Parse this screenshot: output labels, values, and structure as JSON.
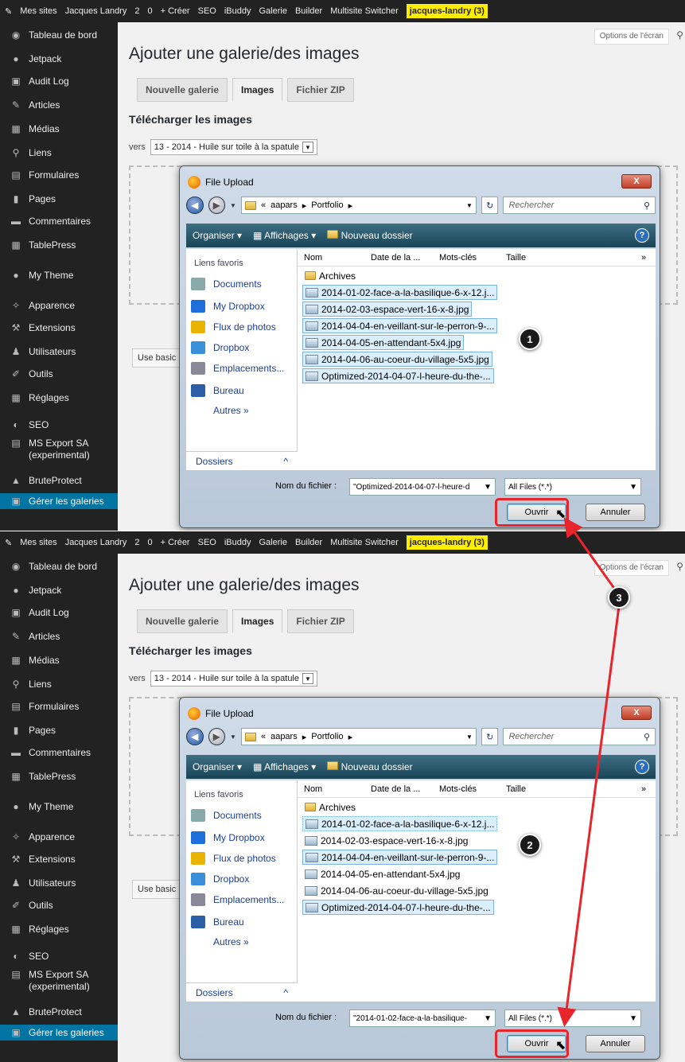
{
  "admin_bar": {
    "items": [
      "Mes sites",
      "Jacques Landry",
      "2",
      "0",
      "+ Créer",
      "SEO",
      "iBuddy",
      "Galerie",
      "Builder",
      "Multisite Switcher"
    ],
    "user": "jacques-landry (3)"
  },
  "sidebar": {
    "items": [
      {
        "label": "Tableau de bord",
        "icon": "dashboard-icon"
      },
      {
        "label": "Jetpack",
        "icon": "jetpack-icon"
      },
      {
        "label": "Audit Log",
        "icon": "audit-icon"
      },
      {
        "label": "Articles",
        "icon": "pin-icon"
      },
      {
        "label": "Médias",
        "icon": "media-icon"
      },
      {
        "label": "Liens",
        "icon": "link-icon"
      },
      {
        "label": "Formulaires",
        "icon": "form-icon"
      },
      {
        "label": "Pages",
        "icon": "page-icon"
      },
      {
        "label": "Commentaires",
        "icon": "comment-icon"
      },
      {
        "label": "TablePress",
        "icon": "table-icon"
      },
      {
        "label": "My Theme",
        "icon": "theme-icon"
      },
      {
        "label": "Apparence",
        "icon": "brush-icon"
      },
      {
        "label": "Extensions",
        "icon": "plugin-icon"
      },
      {
        "label": "Utilisateurs",
        "icon": "users-icon"
      },
      {
        "label": "Outils",
        "icon": "wrench-icon"
      },
      {
        "label": "Réglages",
        "icon": "settings-icon"
      },
      {
        "label": "SEO",
        "icon": "seo-icon"
      },
      {
        "label": "MS Export SA (experimental)",
        "icon": "export-icon"
      },
      {
        "label": "BruteProtect",
        "icon": "lock-icon"
      },
      {
        "label": "Gérer les galeries",
        "icon": "gallery-icon"
      }
    ]
  },
  "page": {
    "screen_options": "Options de l'écran",
    "title": "Ajouter une galerie/des images",
    "tabs": [
      "Nouvelle galerie",
      "Images",
      "Fichier ZIP"
    ],
    "active_tab": "Images",
    "section_title": "Télécharger les images",
    "vers_label": "vers",
    "gallery_select": "13 - 2014 - Huile sur toile à la spatule",
    "basic_button": "Use basic"
  },
  "dialog": {
    "title": "File Upload",
    "close": "X",
    "path_prefix": "«",
    "path": [
      "aapars",
      "Portfolio"
    ],
    "search_placeholder": "Rechercher",
    "toolbar": {
      "organize": "Organiser",
      "views": "Affichages",
      "new_folder": "Nouveau dossier"
    },
    "favorites_label": "Liens favoris",
    "favorites": [
      "Documents",
      "My Dropbox",
      "Flux de photos",
      "Dropbox",
      "Emplacements...",
      "Bureau",
      "Autres »"
    ],
    "folders_label": "Dossiers",
    "columns": [
      "Nom",
      "Date de la ...",
      "Mots-clés",
      "Taille",
      "»"
    ],
    "files": [
      "Archives",
      "2014-01-02-face-a-la-basilique-6-x-12.j...",
      "2014-02-03-espace-vert-16-x-8.jpg",
      "2014-04-04-en-veillant-sur-le-perron-9-...",
      "2014-04-05-en-attendant-5x4.jpg",
      "2014-04-06-au-coeur-du-village-5x5.jpg",
      "Optimized-2014-04-07-l-heure-du-the-..."
    ],
    "filename_label": "Nom du fichier :",
    "filter": "All Files (*.*)",
    "open": "Ouvrir",
    "cancel": "Annuler"
  },
  "panels": [
    {
      "filename": "\"Optimized-2014-04-07-l-heure-d",
      "selected": [
        1,
        2,
        3,
        4,
        5,
        6
      ],
      "marker": "1"
    },
    {
      "filename": "\"2014-01-02-face-a-la-basilique-",
      "selected": [
        1,
        3,
        6
      ],
      "marker": "2"
    }
  ],
  "step3": "3",
  "colors": {
    "annotation_red": "#e8252a",
    "wp_dark": "#222222",
    "wp_blue": "#0074a2"
  }
}
